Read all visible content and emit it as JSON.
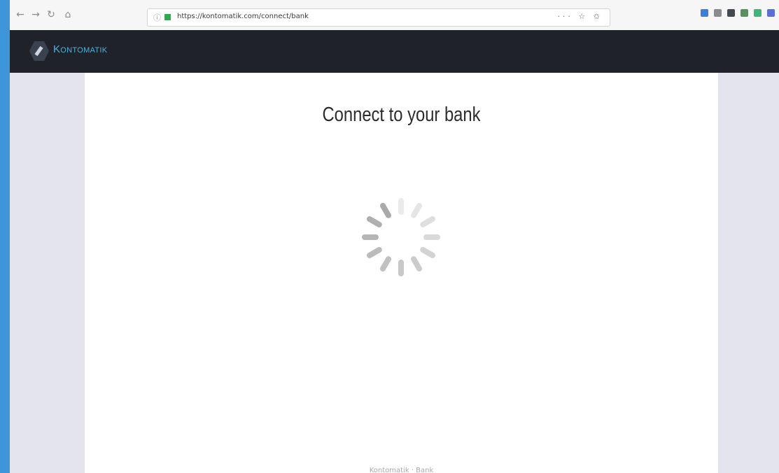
{
  "browser": {
    "url": "https://kontomatik.com/connect/bank",
    "actions": "··· ☆ ✩",
    "nav": {
      "back": "←",
      "forward": "→",
      "reload": "↻",
      "home": "⌂"
    },
    "toolbar_icons": [
      {
        "name": "pocket-icon",
        "color": "#3b7fd6"
      },
      {
        "name": "library-icon",
        "color": "#8a8a90"
      },
      {
        "name": "sidebar-icon",
        "color": "#444a52"
      },
      {
        "name": "extension-icon",
        "color": "#5a8f5f"
      },
      {
        "name": "addon-icon",
        "color": "#3fb57b"
      },
      {
        "name": "screenshot-icon",
        "color": "#5b6fd6"
      }
    ]
  },
  "header": {
    "brand": "Kontomatik",
    "accent": "#4eb2dd",
    "bg": "#1f2329"
  },
  "main": {
    "title": "Connect to your bank",
    "status": "loading",
    "footer": "Kontomatik · Bank"
  }
}
